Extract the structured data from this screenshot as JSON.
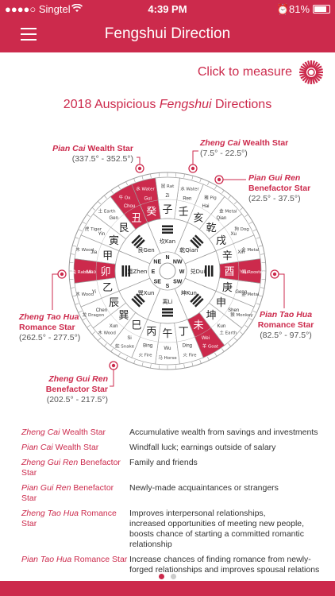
{
  "status": {
    "carrier": "●●●●○ Singtel",
    "time": "4:39 PM",
    "battery": "81%"
  },
  "nav": {
    "title": "Fengshui Direction"
  },
  "measure": {
    "label": "Click to measure"
  },
  "headline": {
    "prefix": "2018 Auspicious ",
    "italic": "Fengshui",
    "suffix": " Directions"
  },
  "stars": {
    "pian_cai": {
      "name_italic": "Pian Cai",
      "name_rest": " Wealth Star",
      "range": "(337.5° - 352.5°)"
    },
    "zheng_cai": {
      "name_italic": "Zheng Cai",
      "name_rest": " Wealth Star",
      "range": "(7.5° - 22.5°)"
    },
    "pian_gui": {
      "name_italic": "Pian Gui Ren",
      "name_rest": "Benefactor Star",
      "range": "(22.5° - 37.5°)"
    },
    "zheng_tao": {
      "name_italic": "Zheng Tao Hua",
      "name_rest": "Romance Star",
      "range": "(262.5° - 277.5°)"
    },
    "pian_tao": {
      "name_italic": "Pian Tao Hua",
      "name_rest": "Romance Star",
      "range": "(82.5° - 97.5°)"
    },
    "zheng_gui": {
      "name_italic": "Zheng Gui Ren",
      "name_rest": "Benefactor Star",
      "range": "(202.5° - 217.5°)"
    }
  },
  "compass": {
    "directions": [
      "S",
      "SW",
      "W",
      "NW",
      "N",
      "NE",
      "E",
      "SE"
    ],
    "trigram_names": [
      "离Li",
      "坤Kun",
      "兑Dui",
      "乾Qian",
      "坎Kan",
      "艮Gen",
      "震Zhen",
      "巽Xun"
    ],
    "sectors": [
      "午",
      "丁",
      "未",
      "坤",
      "申",
      "庚",
      "酉",
      "辛",
      "戌",
      "乾",
      "亥",
      "壬",
      "子",
      "癸",
      "丑",
      "艮",
      "寅",
      "甲",
      "卯",
      "乙",
      "辰",
      "巽",
      "巳",
      "丙"
    ],
    "highlight_sectors": [
      "癸",
      "丑",
      "卯",
      "酉",
      "未"
    ],
    "sector_pinyin": [
      "Wu",
      "Ding",
      "Wei",
      "Kun",
      "Shen",
      "Geng",
      "You",
      "Xin",
      "Xu",
      "Qian",
      "Hai",
      "Ren",
      "Zi",
      "Gui",
      "Chou",
      "Gen",
      "Yin",
      "Jia",
      "Mao",
      "Yi",
      "Chen",
      "Xun",
      "Si",
      "Bing"
    ],
    "animals": [
      "马 Horse",
      "",
      "羊 Goat",
      "",
      "猴 Monkey",
      "",
      "鸡 Rooster",
      "",
      "狗 Dog",
      "",
      "猪 Pig",
      "",
      "鼠 Rat",
      "",
      "牛 Ox",
      "",
      "虎 Tiger",
      "",
      "兔 Rabbit",
      "",
      "龙 Dragon",
      "",
      "蛇 Snake",
      ""
    ],
    "elements": [
      "火 Fire",
      "火 Fire",
      "土 Earth",
      "土 Earth",
      "金 Metal",
      "金 Metal",
      "金 Metal",
      "金 Metal",
      "土 Earth",
      "金 Metal",
      "水 Water",
      "水 Water",
      "水 Water",
      "水 Water",
      "土 Earth",
      "土 Earth",
      "木 Wood",
      "木 Wood",
      "木 Wood",
      "木 Wood",
      "土 Earth",
      "木 Wood",
      "火 Fire",
      "火 Fire"
    ]
  },
  "legend": [
    {
      "italic": "Zheng Cai",
      "rest": " Wealth Star",
      "desc": "Accumulative wealth from savings and investments"
    },
    {
      "italic": "Pian Cai",
      "rest": " Wealth Star",
      "desc": "Windfall luck; earnings outside of salary"
    },
    {
      "italic": "Zheng Gui Ren",
      "rest": " Benefactor Star",
      "desc": "Family and friends"
    },
    {
      "italic": "Pian Gui Ren",
      "rest": " Benefactor Star",
      "desc": "Newly-made acquaintances or strangers"
    },
    {
      "italic": "Zheng Tao Hua",
      "rest": " Romance Star",
      "desc": "Improves interpersonal relationships,\nincreased opportunities of meeting new people,\nboosts chance of starting a committed romantic\nrelationship"
    },
    {
      "italic": "Pian Tao Hua",
      "rest": " Romance Star",
      "desc": "Increase chances of finding romance from newly-\nforged relationships and improves spousal relations"
    }
  ],
  "colors": {
    "accent": "#cc2a4c"
  }
}
